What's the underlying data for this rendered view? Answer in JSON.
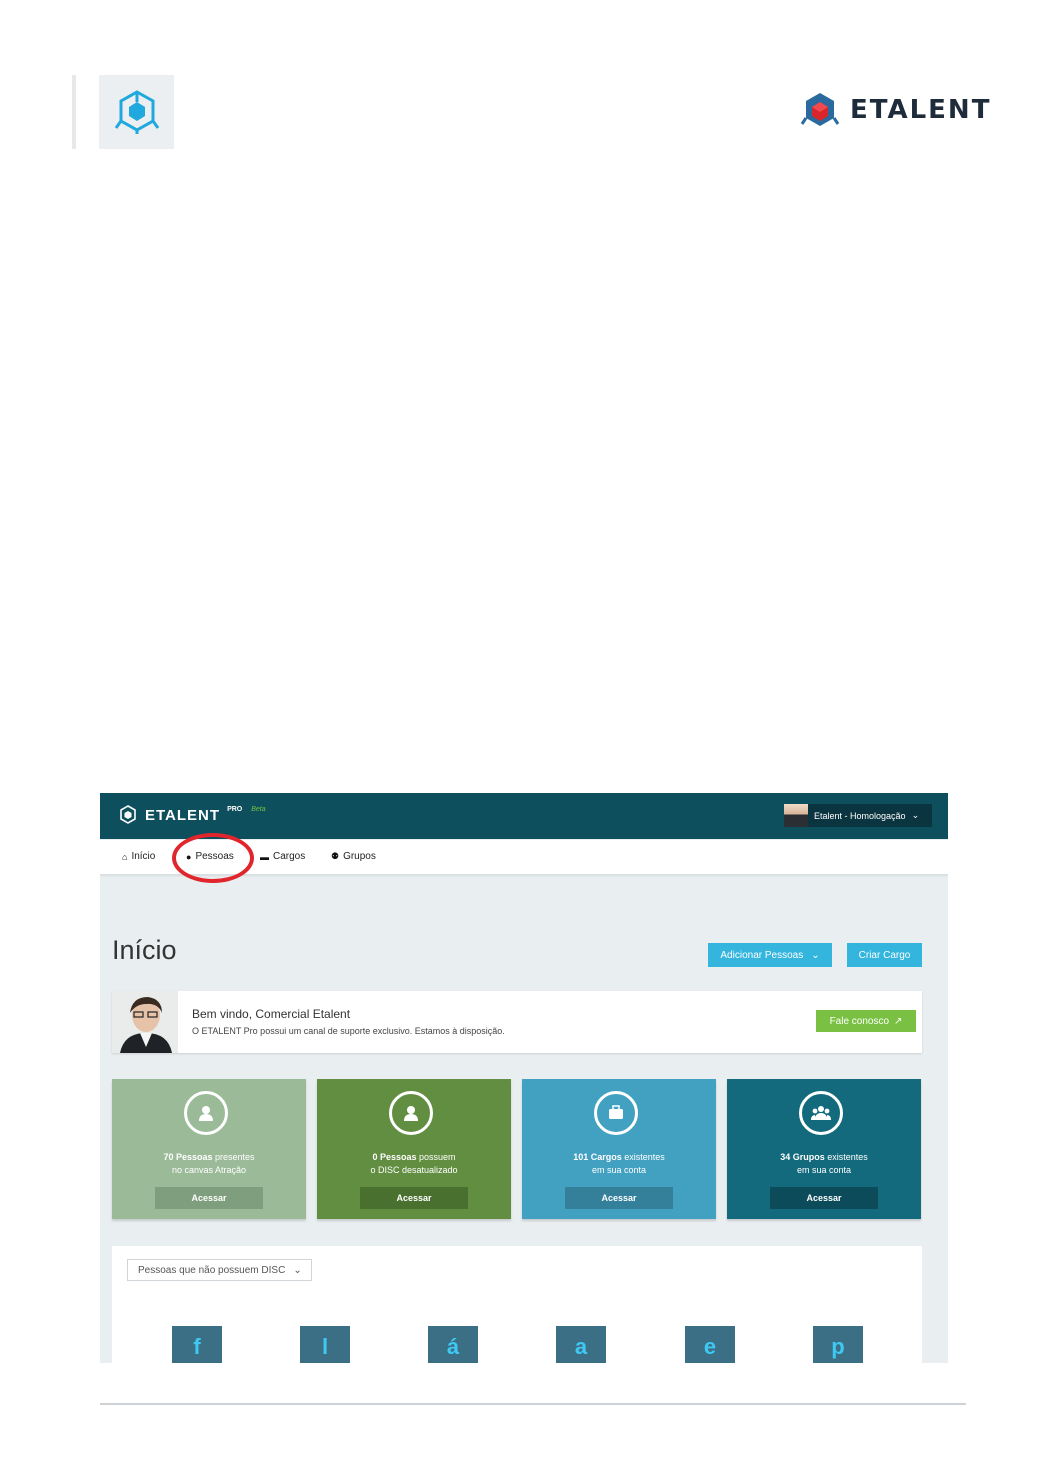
{
  "document_header": {
    "brand_name": "ETALENT"
  },
  "app": {
    "logo_text": "ETALENT",
    "logo_pro": "PRO",
    "logo_beta": "Beta",
    "user_menu": "Etalent - Homologação",
    "nav": [
      {
        "label": "Início",
        "icon": "home-icon"
      },
      {
        "label": "Pessoas",
        "icon": "user-icon"
      },
      {
        "label": "Cargos",
        "icon": "briefcase-icon"
      },
      {
        "label": "Grupos",
        "icon": "users-icon"
      }
    ],
    "page_title": "Início",
    "btn_add_people": "Adicionar Pessoas",
    "btn_create_role": "Criar Cargo",
    "welcome": {
      "title": "Bem vindo, Comercial Etalent",
      "subtitle": "O ETALENT Pro possui um canal de suporte exclusivo. Estamos à disposição.",
      "button": "Fale conosco"
    },
    "cards": [
      {
        "bold": "70 Pessoas",
        "rest": " presentes",
        "line2": "no canvas Atração",
        "button": "Acessar",
        "icon": "user-icon",
        "color": "#9bbb98",
        "btn_color": "#7f9e7d"
      },
      {
        "bold": "0 Pessoas",
        "rest": " possuem",
        "line2": "o DISC desatualizado",
        "button": "Acessar",
        "icon": "user-icon",
        "color": "#628e41",
        "btn_color": "#4a7030"
      },
      {
        "bold": "101 Cargos",
        "rest": " existentes",
        "line2": "em sua conta",
        "button": "Acessar",
        "icon": "briefcase-icon",
        "color": "#42a0c1",
        "btn_color": "#347f9a"
      },
      {
        "bold": "34 Grupos",
        "rest": " existentes",
        "line2": "em sua conta",
        "button": "Acessar",
        "icon": "users-icon",
        "color": "#126a7c",
        "btn_color": "#0c4c5a"
      }
    ],
    "filter_select": "Pessoas que não possuem DISC",
    "letters": [
      "f",
      "l",
      "á",
      "a",
      "e",
      "p"
    ]
  }
}
